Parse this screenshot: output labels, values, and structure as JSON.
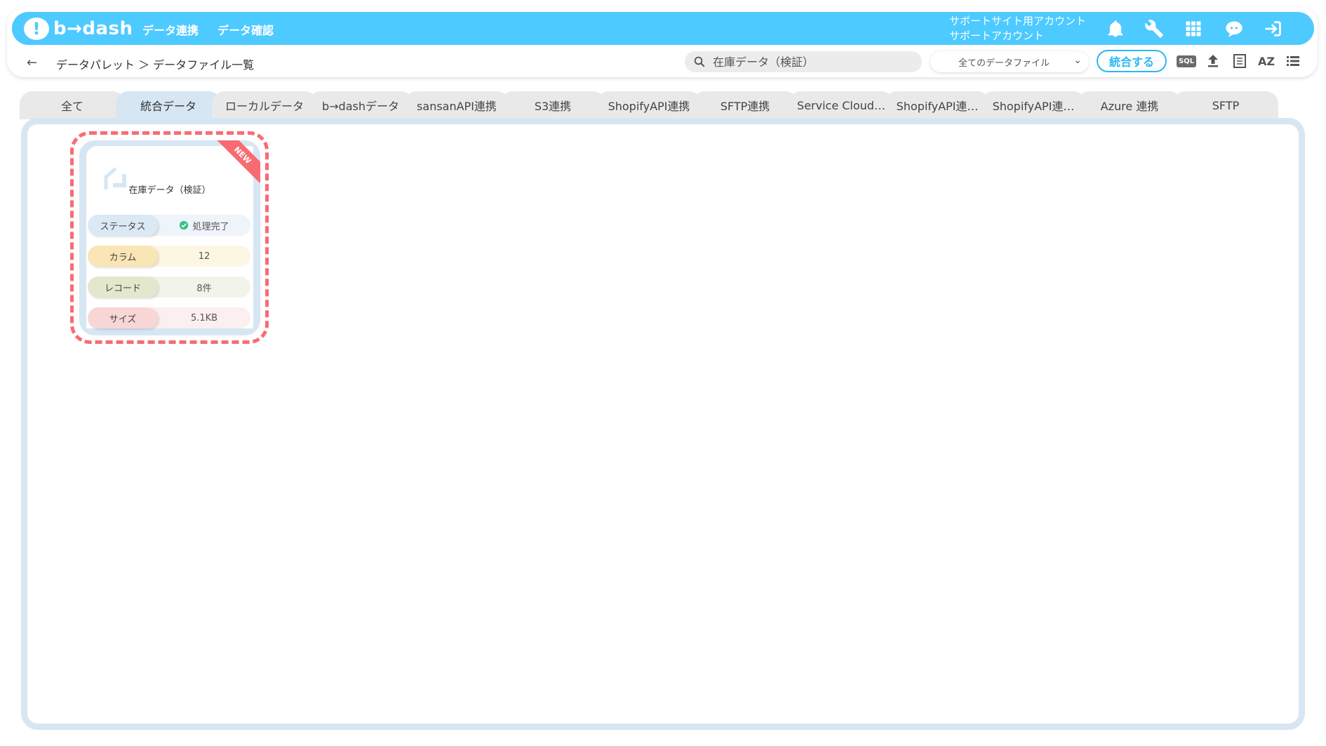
{
  "app": {
    "logo_text": "b→dash",
    "nav": [
      "データ連携",
      "データ確認"
    ],
    "account_line1": "サポートサイト用アカウント",
    "account_line2": "サポートアカウント"
  },
  "toolbar": {
    "breadcrumb": "データパレット ＞ データファイル一覧",
    "search_placeholder": "在庫データ（検証）",
    "filter_label": "全てのデータファイル",
    "merge_label": "統合する",
    "sql_label": "SQL",
    "sort_label": "AZ"
  },
  "tabs": [
    {
      "label": "全て",
      "active": false
    },
    {
      "label": "統合データ",
      "active": true
    },
    {
      "label": "ローカルデータ",
      "active": false
    },
    {
      "label": "b→dashデータ",
      "active": false
    },
    {
      "label": "sansanAPI連携",
      "active": false
    },
    {
      "label": "S3連携",
      "active": false
    },
    {
      "label": "ShopifyAPI連携",
      "active": false
    },
    {
      "label": "SFTP連携",
      "active": false
    },
    {
      "label": "Service Cloud…",
      "active": false
    },
    {
      "label": "ShopifyAPI連…",
      "active": false
    },
    {
      "label": "ShopifyAPI連…",
      "active": false
    },
    {
      "label": "Azure 連携",
      "active": false
    },
    {
      "label": "SFTP",
      "active": false
    }
  ],
  "file_card": {
    "badge": "NEW",
    "title": "在庫データ（検証）",
    "rows": [
      {
        "label": "ステータス",
        "value": "処理完了"
      },
      {
        "label": "カラム",
        "value": "12"
      },
      {
        "label": "レコード",
        "value": "8件"
      },
      {
        "label": "サイズ",
        "value": "5.1KB"
      }
    ]
  },
  "colors": {
    "brand": "#4dcaff",
    "accent_red": "#f86b73",
    "panel_border": "#d7e6f3",
    "status_ok": "#3bbf8a"
  }
}
